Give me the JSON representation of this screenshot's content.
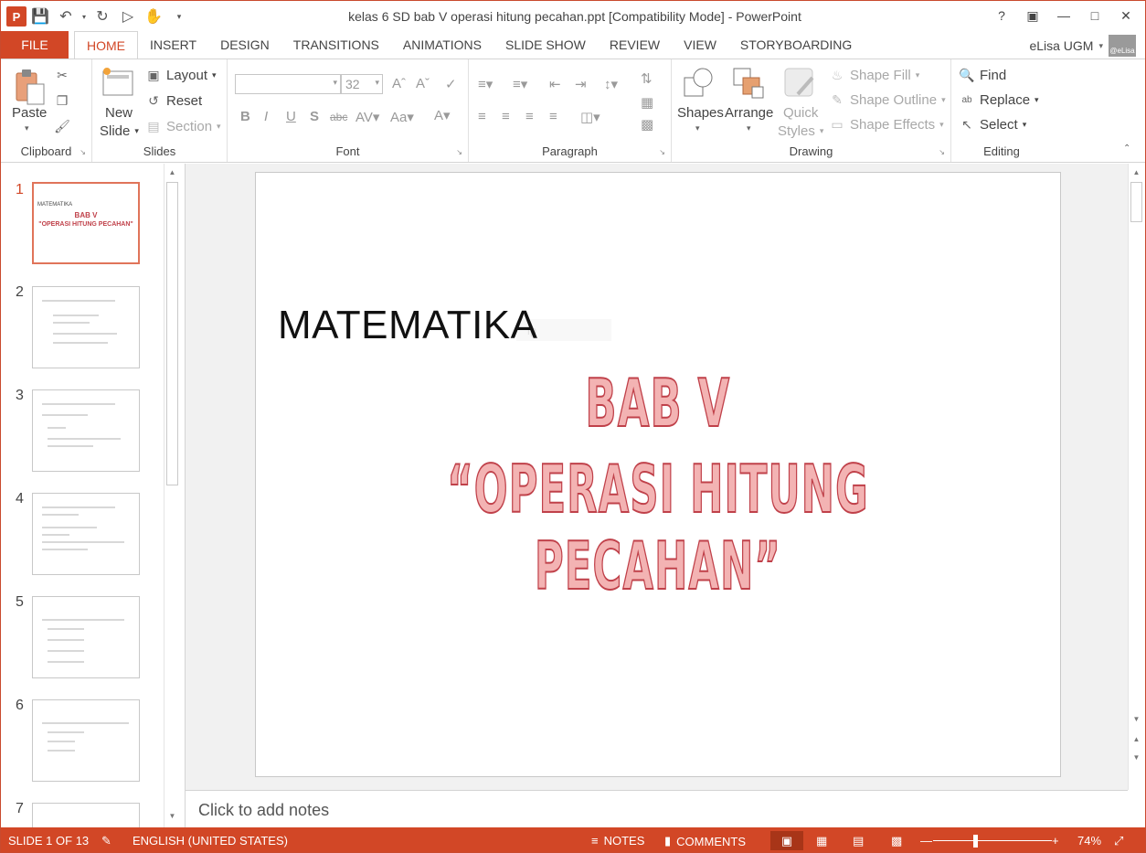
{
  "window": {
    "title": "kelas 6 SD bab V operasi hitung pecahan.ppt [Compatibility Mode] - PowerPoint",
    "app_icon": "P",
    "help": "?",
    "buttons": [
      "help",
      "ribbon-display",
      "minimize",
      "restore",
      "close"
    ]
  },
  "tabs": {
    "file": "FILE",
    "items": [
      "HOME",
      "INSERT",
      "DESIGN",
      "TRANSITIONS",
      "ANIMATIONS",
      "SLIDE SHOW",
      "REVIEW",
      "VIEW",
      "STORYBOARDING"
    ],
    "active": "HOME"
  },
  "user": {
    "name": "eLisa UGM",
    "avatar_text": "@eLisa"
  },
  "ribbon": {
    "clipboard": {
      "paste": "Paste",
      "label": "Clipboard"
    },
    "slides": {
      "new_slide_line1": "New",
      "new_slide_line2": "Slide",
      "layout": "Layout",
      "reset": "Reset",
      "section": "Section",
      "label": "Slides"
    },
    "font": {
      "font_size": "32",
      "label": "Font"
    },
    "paragraph": {
      "label": "Paragraph"
    },
    "drawing": {
      "shapes": "Shapes",
      "arrange": "Arrange",
      "quick_styles_line1": "Quick",
      "quick_styles_line2": "Styles",
      "shape_fill": "Shape Fill",
      "shape_outline": "Shape Outline",
      "shape_effects": "Shape Effects",
      "label": "Drawing"
    },
    "editing": {
      "find": "Find",
      "replace": "Replace",
      "select": "Select",
      "label": "Editing"
    }
  },
  "thumbnails": [
    {
      "num": "1",
      "title": "MATEMATIKA",
      "line1": "BAB V",
      "line2": "\"OPERASI HITUNG PECAHAN\""
    },
    {
      "num": "2"
    },
    {
      "num": "3"
    },
    {
      "num": "4"
    },
    {
      "num": "5"
    },
    {
      "num": "6"
    },
    {
      "num": "7"
    }
  ],
  "slide": {
    "title": "MATEMATIKA",
    "ghost_text": "ip",
    "wordart_line1": "BAB V",
    "wordart_line2": "“OPERASI HITUNG PECAHAN”"
  },
  "notes": {
    "placeholder": "Click to add notes"
  },
  "status": {
    "slide_info": "SLIDE 1 OF 13",
    "language": "ENGLISH (UNITED STATES)",
    "notes": "NOTES",
    "comments": "COMMENTS",
    "zoom": "74%"
  },
  "colors": {
    "accent": "#d24726",
    "wordart_fill": "#f3b3b3",
    "wordart_stroke": "#c0414a"
  }
}
